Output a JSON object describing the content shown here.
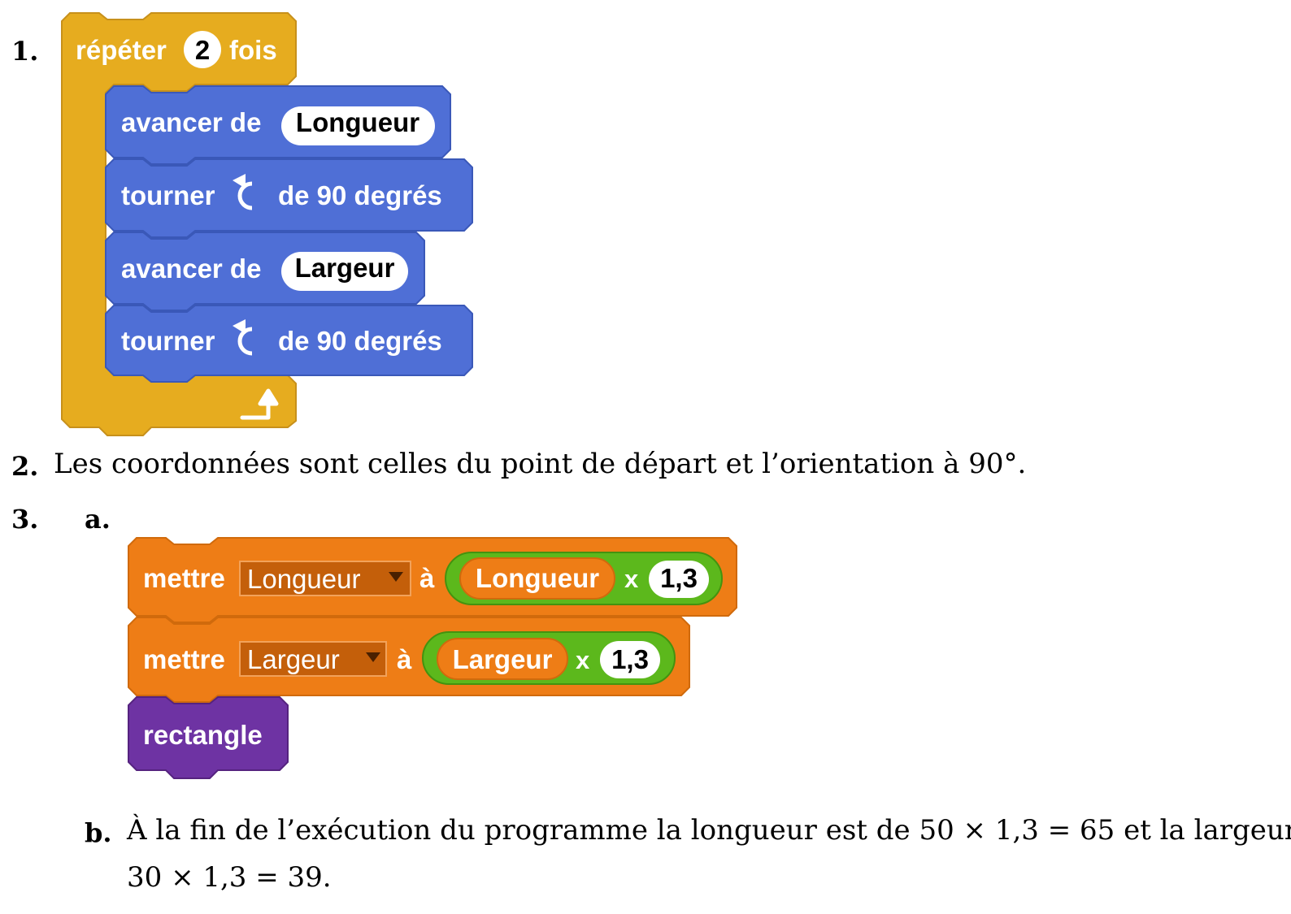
{
  "items": {
    "q1": {
      "number": "1."
    },
    "q2": {
      "number": "2.",
      "text": "Les coordonnées sont celles du point de départ et l’orientation à 90°."
    },
    "q3": {
      "number": "3.",
      "a": {
        "label": "a."
      },
      "b": {
        "label": "b.",
        "line1": "À la fin de l’exécution du programme la longueur est de 50 × 1,3 = 65 et la largeur à",
        "line2": "30 × 1,3 = 39."
      }
    }
  },
  "scratch1": {
    "repeat": {
      "label": "répéter",
      "count": "2",
      "suffix": "fois"
    },
    "blocks": [
      {
        "prefix": "avancer de",
        "value": "Longueur"
      },
      {
        "prefix": "tourner",
        "suffix": "de 90 degrés"
      },
      {
        "prefix": "avancer de",
        "value": "Largeur"
      },
      {
        "prefix": "tourner",
        "suffix": "de 90 degrés"
      }
    ]
  },
  "scratch2": {
    "set_blocks": [
      {
        "label": "mettre",
        "variable": "Longueur",
        "to": "à",
        "reporter": "Longueur",
        "op": "x",
        "factor": "1,3"
      },
      {
        "label": "mettre",
        "variable": "Largeur",
        "to": "à",
        "reporter": "Largeur",
        "op": "x",
        "factor": "1,3"
      }
    ],
    "custom_block": {
      "label": "rectangle"
    }
  },
  "colors": {
    "control": "#e6ac1f",
    "motion": "#4f6fd6",
    "variables": "#ee7d16",
    "operators": "#5cb81c",
    "custom": "#6e33a3"
  }
}
